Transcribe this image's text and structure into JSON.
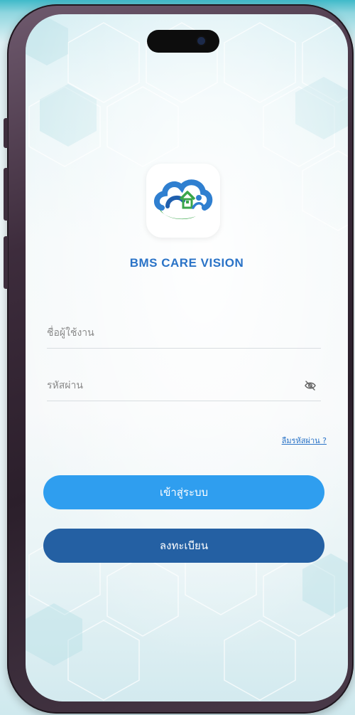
{
  "app": {
    "title": "BMS CARE VISION"
  },
  "form": {
    "username_placeholder": "ชื่อผู้ใช้งาน",
    "username_value": "",
    "password_placeholder": "รหัสผ่าน",
    "password_value": "",
    "forgot_password_label": "ลืมรหัสผ่าน ?"
  },
  "actions": {
    "login_label": "เข้าสู่ระบบ",
    "register_label": "ลงทะเบียน"
  },
  "icons": {
    "logo": "bms-care-vision-logo",
    "password_toggle": "eye-slash-icon"
  },
  "colors": {
    "title": "#2a73c7",
    "login_button": "#2f9eef",
    "register_button": "#2460a3",
    "link": "#2a73c7",
    "logo_green": "#3aa64a",
    "logo_blue": "#2f7fd0"
  }
}
